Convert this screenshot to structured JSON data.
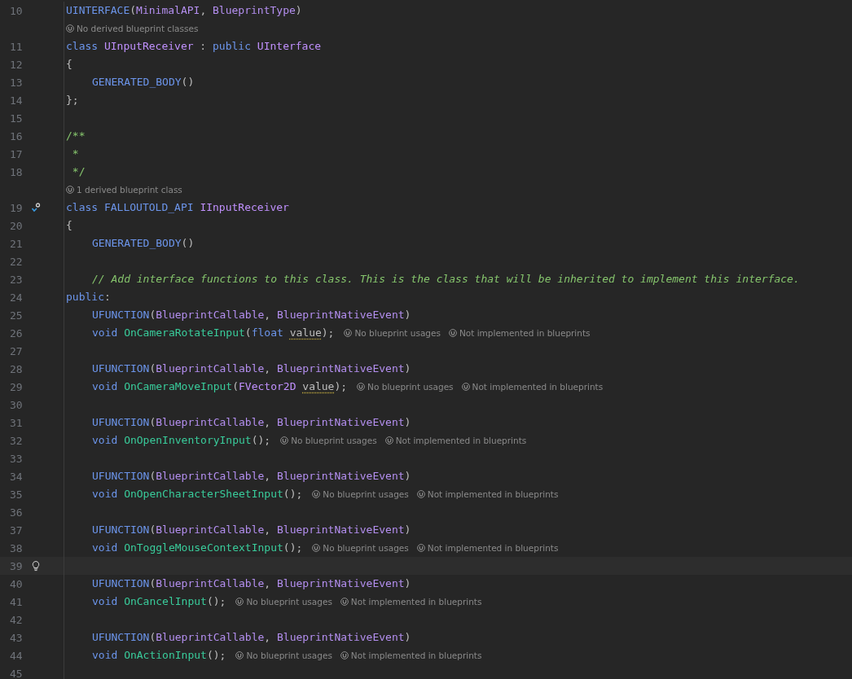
{
  "lines": [
    {
      "kind": "code",
      "number": "10",
      "tokens": [
        {
          "text": "UINTERFACE",
          "kind": "macro"
        },
        {
          "text": "(",
          "kind": "text"
        },
        {
          "text": "MinimalAPI",
          "kind": "arg"
        },
        {
          "text": ", ",
          "kind": "text"
        },
        {
          "text": "BlueprintType",
          "kind": "arg"
        },
        {
          "text": ")",
          "kind": "text"
        }
      ]
    },
    {
      "kind": "lens",
      "text": "No derived blueprint classes"
    },
    {
      "kind": "code",
      "number": "11",
      "tokens": [
        {
          "text": "class ",
          "kind": "kw"
        },
        {
          "text": "UInputReceiver",
          "kind": "type"
        },
        {
          "text": " : ",
          "kind": "text"
        },
        {
          "text": "public ",
          "kind": "kw"
        },
        {
          "text": "UInterface",
          "kind": "type"
        }
      ]
    },
    {
      "kind": "code",
      "number": "12",
      "tokens": [
        {
          "text": "{",
          "kind": "text"
        }
      ]
    },
    {
      "kind": "code",
      "number": "13",
      "indent": true,
      "tokens": [
        {
          "text": "GENERATED_BODY",
          "kind": "macro"
        },
        {
          "text": "()",
          "kind": "text"
        }
      ]
    },
    {
      "kind": "code",
      "number": "14",
      "tokens": [
        {
          "text": "};",
          "kind": "text"
        }
      ]
    },
    {
      "kind": "code",
      "number": "15"
    },
    {
      "kind": "code",
      "number": "16",
      "tokens": [
        {
          "text": "/**",
          "kind": "doc"
        }
      ]
    },
    {
      "kind": "code",
      "number": "17",
      "tokens": [
        {
          "text": " *",
          "kind": "doc"
        }
      ]
    },
    {
      "kind": "code",
      "number": "18",
      "tokens": [
        {
          "text": " */",
          "kind": "doc"
        }
      ]
    },
    {
      "kind": "lens",
      "text": "1 derived blueprint class"
    },
    {
      "kind": "code",
      "number": "19",
      "implemented": true,
      "tokens": [
        {
          "text": "class ",
          "kind": "kw"
        },
        {
          "text": "FALLOUTOLD_API ",
          "kind": "macro"
        },
        {
          "text": "IInputReceiver",
          "kind": "type"
        }
      ]
    },
    {
      "kind": "code",
      "number": "20",
      "tokens": [
        {
          "text": "{",
          "kind": "text"
        }
      ]
    },
    {
      "kind": "code",
      "number": "21",
      "indent": true,
      "tokens": [
        {
          "text": "GENERATED_BODY",
          "kind": "macro"
        },
        {
          "text": "()",
          "kind": "text"
        }
      ]
    },
    {
      "kind": "code",
      "number": "22"
    },
    {
      "kind": "code",
      "number": "23",
      "indent": true,
      "tokens": [
        {
          "text": "// Add interface functions to this class. This is the class that will be inherited to implement this interface.",
          "kind": "comment"
        }
      ]
    },
    {
      "kind": "code",
      "number": "24",
      "tokens": [
        {
          "text": "public",
          "kind": "kw"
        },
        {
          "text": ":",
          "kind": "text"
        }
      ]
    },
    {
      "kind": "code",
      "number": "25",
      "indent": true,
      "tokens": [
        {
          "text": "UFUNCTION",
          "kind": "macro"
        },
        {
          "text": "(",
          "kind": "text"
        },
        {
          "text": "BlueprintCallable",
          "kind": "arg"
        },
        {
          "text": ", ",
          "kind": "text"
        },
        {
          "text": "BlueprintNativeEvent",
          "kind": "arg"
        },
        {
          "text": ")",
          "kind": "text"
        }
      ]
    },
    {
      "kind": "code",
      "number": "26",
      "indent": true,
      "tokens": [
        {
          "text": "void ",
          "kind": "kw"
        },
        {
          "text": "OnCameraRotateInput",
          "kind": "fn"
        },
        {
          "text": "(",
          "kind": "text"
        },
        {
          "text": "float ",
          "kind": "kw"
        },
        {
          "text": "value",
          "kind": "param"
        },
        {
          "text": ");",
          "kind": "text"
        }
      ],
      "hints": [
        "No blueprint usages",
        "Not implemented in blueprints"
      ]
    },
    {
      "kind": "code",
      "number": "27"
    },
    {
      "kind": "code",
      "number": "28",
      "indent": true,
      "tokens": [
        {
          "text": "UFUNCTION",
          "kind": "macro"
        },
        {
          "text": "(",
          "kind": "text"
        },
        {
          "text": "BlueprintCallable",
          "kind": "arg"
        },
        {
          "text": ", ",
          "kind": "text"
        },
        {
          "text": "BlueprintNativeEvent",
          "kind": "arg"
        },
        {
          "text": ")",
          "kind": "text"
        }
      ]
    },
    {
      "kind": "code",
      "number": "29",
      "indent": true,
      "tokens": [
        {
          "text": "void ",
          "kind": "kw"
        },
        {
          "text": "OnCameraMoveInput",
          "kind": "fn"
        },
        {
          "text": "(",
          "kind": "text"
        },
        {
          "text": "FVector2D ",
          "kind": "type"
        },
        {
          "text": "value",
          "kind": "param"
        },
        {
          "text": ");",
          "kind": "text"
        }
      ],
      "hints": [
        "No blueprint usages",
        "Not implemented in blueprints"
      ]
    },
    {
      "kind": "code",
      "number": "30"
    },
    {
      "kind": "code",
      "number": "31",
      "indent": true,
      "tokens": [
        {
          "text": "UFUNCTION",
          "kind": "macro"
        },
        {
          "text": "(",
          "kind": "text"
        },
        {
          "text": "BlueprintCallable",
          "kind": "arg"
        },
        {
          "text": ", ",
          "kind": "text"
        },
        {
          "text": "BlueprintNativeEvent",
          "kind": "arg"
        },
        {
          "text": ")",
          "kind": "text"
        }
      ]
    },
    {
      "kind": "code",
      "number": "32",
      "indent": true,
      "tokens": [
        {
          "text": "void ",
          "kind": "kw"
        },
        {
          "text": "OnOpenInventoryInput",
          "kind": "fn"
        },
        {
          "text": "();",
          "kind": "text"
        }
      ],
      "hints": [
        "No blueprint usages",
        "Not implemented in blueprints"
      ]
    },
    {
      "kind": "code",
      "number": "33"
    },
    {
      "kind": "code",
      "number": "34",
      "indent": true,
      "tokens": [
        {
          "text": "UFUNCTION",
          "kind": "macro"
        },
        {
          "text": "(",
          "kind": "text"
        },
        {
          "text": "BlueprintCallable",
          "kind": "arg"
        },
        {
          "text": ", ",
          "kind": "text"
        },
        {
          "text": "BlueprintNativeEvent",
          "kind": "arg"
        },
        {
          "text": ")",
          "kind": "text"
        }
      ]
    },
    {
      "kind": "code",
      "number": "35",
      "indent": true,
      "tokens": [
        {
          "text": "void ",
          "kind": "kw"
        },
        {
          "text": "OnOpenCharacterSheetInput",
          "kind": "fn"
        },
        {
          "text": "();",
          "kind": "text"
        }
      ],
      "hints": [
        "No blueprint usages",
        "Not implemented in blueprints"
      ]
    },
    {
      "kind": "code",
      "number": "36"
    },
    {
      "kind": "code",
      "number": "37",
      "indent": true,
      "tokens": [
        {
          "text": "UFUNCTION",
          "kind": "macro"
        },
        {
          "text": "(",
          "kind": "text"
        },
        {
          "text": "BlueprintCallable",
          "kind": "arg"
        },
        {
          "text": ", ",
          "kind": "text"
        },
        {
          "text": "BlueprintNativeEvent",
          "kind": "arg"
        },
        {
          "text": ")",
          "kind": "text"
        }
      ]
    },
    {
      "kind": "code",
      "number": "38",
      "indent": true,
      "tokens": [
        {
          "text": "void ",
          "kind": "kw"
        },
        {
          "text": "OnToggleMouseContextInput",
          "kind": "fn"
        },
        {
          "text": "();",
          "kind": "text"
        }
      ],
      "hints": [
        "No blueprint usages",
        "Not implemented in blueprints"
      ]
    },
    {
      "kind": "code",
      "number": "39",
      "bulb": true,
      "current": true
    },
    {
      "kind": "code",
      "number": "40",
      "indent": true,
      "tokens": [
        {
          "text": "UFUNCTION",
          "kind": "macro"
        },
        {
          "text": "(",
          "kind": "text"
        },
        {
          "text": "BlueprintCallable",
          "kind": "arg"
        },
        {
          "text": ", ",
          "kind": "text"
        },
        {
          "text": "BlueprintNativeEvent",
          "kind": "arg"
        },
        {
          "text": ")",
          "kind": "text"
        }
      ]
    },
    {
      "kind": "code",
      "number": "41",
      "indent": true,
      "tokens": [
        {
          "text": "void ",
          "kind": "kw"
        },
        {
          "text": "OnCancelInput",
          "kind": "fn"
        },
        {
          "text": "();",
          "kind": "text"
        }
      ],
      "hints": [
        "No blueprint usages",
        "Not implemented in blueprints"
      ]
    },
    {
      "kind": "code",
      "number": "42"
    },
    {
      "kind": "code",
      "number": "43",
      "indent": true,
      "tokens": [
        {
          "text": "UFUNCTION",
          "kind": "macro"
        },
        {
          "text": "(",
          "kind": "text"
        },
        {
          "text": "BlueprintCallable",
          "kind": "arg"
        },
        {
          "text": ", ",
          "kind": "text"
        },
        {
          "text": "BlueprintNativeEvent",
          "kind": "arg"
        },
        {
          "text": ")",
          "kind": "text"
        }
      ]
    },
    {
      "kind": "code",
      "number": "44",
      "indent": true,
      "tokens": [
        {
          "text": "void ",
          "kind": "kw"
        },
        {
          "text": "OnActionInput",
          "kind": "fn"
        },
        {
          "text": "();",
          "kind": "text"
        }
      ],
      "hints": [
        "No blueprint usages",
        "Not implemented in blueprints"
      ]
    },
    {
      "kind": "code",
      "number": "45"
    }
  ]
}
